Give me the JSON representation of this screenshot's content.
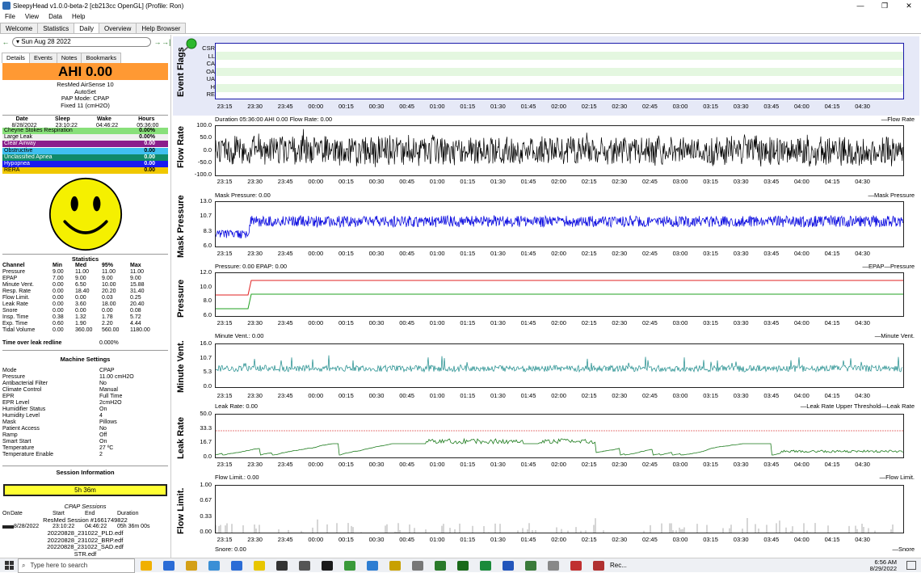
{
  "window": {
    "title": "SleepyHead v1.0.0-beta-2 [cb213cc OpenGL] (Profile: Ron)",
    "controls": [
      "—",
      "❐",
      "✕"
    ]
  },
  "menu": [
    "File",
    "View",
    "Data",
    "Help"
  ],
  "tabs": [
    "Welcome",
    "Statistics",
    "Daily",
    "Overview",
    "Help Browser"
  ],
  "active_tab": "Daily",
  "datenav": {
    "date": "Sun Aug 28 2022"
  },
  "subtabs": [
    "Details",
    "Events",
    "Notes",
    "Bookmarks"
  ],
  "ahi": "AHI 0.00",
  "machine": {
    "model": "ResMed AirSense 10",
    "type": "AutoSet",
    "mode": "PAP Mode: CPAP",
    "fixed": "Fixed 11 (cmH2O)"
  },
  "sleep": {
    "headers": [
      "Date",
      "Sleep",
      "Wake",
      "Hours"
    ],
    "values": [
      "8/28/2022",
      "23:10:22",
      "04:46:22",
      "05:36:00"
    ]
  },
  "events": [
    {
      "name": "Cheyne Stokes Respiration",
      "value": "0.00%",
      "color": "#88e07a"
    },
    {
      "name": "Large Leak",
      "value": "0.00%",
      "color": "#f0f0f0"
    },
    {
      "name": "Clear Airway",
      "value": "0.00",
      "color": "#8b1f8b",
      "text": "#ffffff"
    },
    {
      "name": "Obstructive",
      "value": "0.00",
      "color": "#40c0f0"
    },
    {
      "name": "Unclassified Apnea",
      "value": "0.00",
      "color": "#108a6a",
      "text": "#ffffff"
    },
    {
      "name": "Hypopnea",
      "value": "0.00",
      "color": "#1a1af0",
      "text": "#ffffff"
    },
    {
      "name": "RERA",
      "value": "0.00",
      "color": "#f0c800"
    }
  ],
  "statistics": {
    "title": "Statistics",
    "headers": [
      "Channel",
      "Min",
      "Med",
      "95%",
      "Max"
    ],
    "rows": [
      [
        "Pressure",
        "9.00",
        "11.00",
        "11.00",
        "11.00"
      ],
      [
        "EPAP",
        "7.00",
        "9.00",
        "9.00",
        "9.00"
      ],
      [
        "Minute Vent.",
        "0.00",
        "6.50",
        "10.00",
        "15.88"
      ],
      [
        "Resp. Rate",
        "0.00",
        "18.40",
        "20.20",
        "31.40"
      ],
      [
        "Flow Limit.",
        "0.00",
        "0.00",
        "0.03",
        "0.25"
      ],
      [
        "Leak Rate",
        "0.00",
        "3.60",
        "18.00",
        "20.40"
      ],
      [
        "Snore",
        "0.00",
        "0.00",
        "0.00",
        "0.08"
      ],
      [
        "Insp. Time",
        "0.38",
        "1.32",
        "1.78",
        "5.72"
      ],
      [
        "Exp. Time",
        "0.60",
        "1.90",
        "2.20",
        "4.44"
      ],
      [
        "Tidal Volume",
        "0.00",
        "360.00",
        "560.00",
        "1180.00"
      ]
    ]
  },
  "leak_redline": {
    "label": "Time over leak redline",
    "value": "0.000%"
  },
  "machine_settings": {
    "title": "Machine Settings",
    "rows": [
      [
        "Mode",
        "CPAP"
      ],
      [
        "Pressure",
        "11.00 cmH2O"
      ],
      [
        "Antibacterial Filter",
        "No"
      ],
      [
        "Climate Control",
        "Manual"
      ],
      [
        "EPR",
        "Full Time"
      ],
      [
        "EPR Level",
        "2cmH2O"
      ],
      [
        "Humidifier Status",
        "On"
      ],
      [
        "Humidity Level",
        "4"
      ],
      [
        "Mask",
        "Pillows"
      ],
      [
        "Patient Access",
        "No"
      ],
      [
        "Ramp",
        "Off"
      ],
      [
        "Smart Start",
        "On"
      ],
      [
        "Temperature",
        "27 ºC"
      ],
      [
        "Temperature Enable",
        "2"
      ]
    ]
  },
  "session_info": {
    "title": "Session Information",
    "bar": "5h 36m"
  },
  "cpap_sessions": {
    "title": "CPAP Sessions",
    "headers": [
      "On",
      "Date",
      "Start",
      "End",
      "Duration"
    ],
    "session_line": "ResMed Session #1661749822",
    "row": [
      "8/28/2022",
      "23:10:22",
      "04:46:22",
      "05h 36m 00s"
    ],
    "files": [
      "20220828_231022_PLD.edf",
      "20220828_231022_BRP.edf",
      "20220828_231022_SAD.edf",
      "STR.edf"
    ]
  },
  "xticks": [
    "23:15",
    "23:30",
    "23:45",
    "00:00",
    "00:15",
    "00:30",
    "00:45",
    "01:00",
    "01:15",
    "01:30",
    "01:45",
    "02:00",
    "02:15",
    "02:30",
    "02:45",
    "03:00",
    "03:15",
    "03:30",
    "03:45",
    "04:00",
    "04:15",
    "04:30"
  ],
  "charts": {
    "event_flags": {
      "ylabel": "Event Flags",
      "rows": [
        "CSR",
        "LL",
        "CA",
        "OA",
        "UA",
        "H",
        "RE"
      ]
    },
    "flow_rate": {
      "ylabel": "Flow Rate",
      "title": "Duration 05:36:00 AHI 0.00 Flow Rate: 0.00",
      "legend": "Flow Rate",
      "yticks": [
        "100.0",
        "50.0",
        "0.0",
        "-50.0",
        "-100.0"
      ]
    },
    "mask_pressure": {
      "ylabel": "Mask Pressure",
      "title": "Mask Pressure: 0.00",
      "legend": "Mask Pressure",
      "yticks": [
        "13.0",
        "10.7",
        "8.3",
        "6.0"
      ]
    },
    "pressure": {
      "ylabel": "Pressure",
      "title": "Pressure: 0.00 EPAP: 0.00",
      "legend": [
        "EPAP",
        "Pressure"
      ],
      "yticks": [
        "12.0",
        "10.0",
        "8.0",
        "6.0"
      ]
    },
    "minute_vent": {
      "ylabel": "Minute Vent.",
      "title": "Minute Vent.: 0.00",
      "legend": "Minute Vent.",
      "yticks": [
        "16.0",
        "10.7",
        "5.3",
        "0.0"
      ]
    },
    "leak_rate": {
      "ylabel": "Leak Rate",
      "title": "Leak Rate: 0.00",
      "legend": [
        "Leak Rate Upper Threshold",
        "Leak Rate"
      ],
      "yticks": [
        "50.0",
        "33.3",
        "16.7",
        "0.0"
      ]
    },
    "flow_limit": {
      "ylabel": "Flow Limit.",
      "title": "Flow Limit.: 0.00",
      "legend": "Flow Limit.",
      "yticks": [
        "1.00",
        "0.67",
        "0.33",
        "0.00"
      ]
    },
    "snore": {
      "title": "Snore: 0.00",
      "legend": "Snore"
    }
  },
  "taskbar": {
    "search": "Type here to search",
    "app_label": "Rec...",
    "time": "6:56 AM",
    "date": "8/29/2022"
  }
}
